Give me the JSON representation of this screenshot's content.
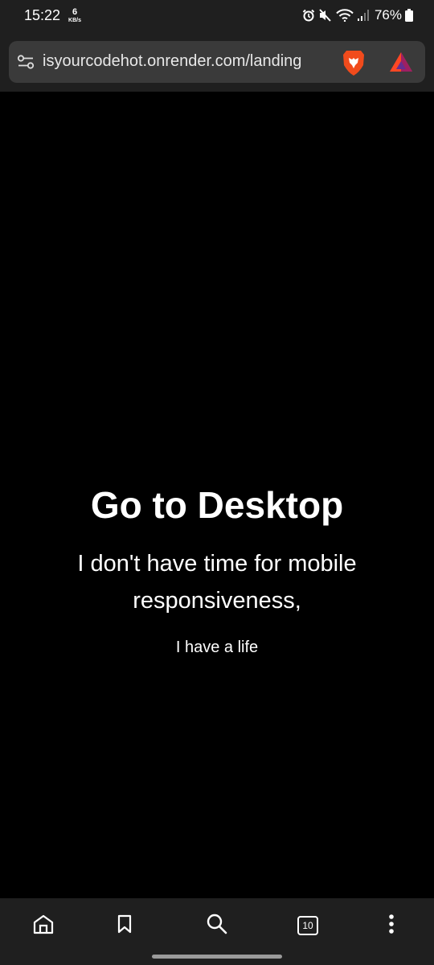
{
  "status_bar": {
    "time": "15:22",
    "net_speed_value": "6",
    "net_speed_unit": "KB/s",
    "battery_percent": "76%"
  },
  "browser": {
    "url": "isyourcodehot.onrender.com/landing",
    "brave_color": "#f14b1c",
    "bat_colors": [
      "#ff4724",
      "#9e1f63",
      "#662d91"
    ]
  },
  "page": {
    "heading": "Go to Desktop",
    "subheading": "I don't have time for mobile responsiveness,",
    "note": "I have a life"
  },
  "bottom_nav": {
    "tab_count": "10",
    "icons": [
      "home-icon",
      "bookmark-icon",
      "search-icon",
      "tabs-icon",
      "more-icon"
    ]
  }
}
